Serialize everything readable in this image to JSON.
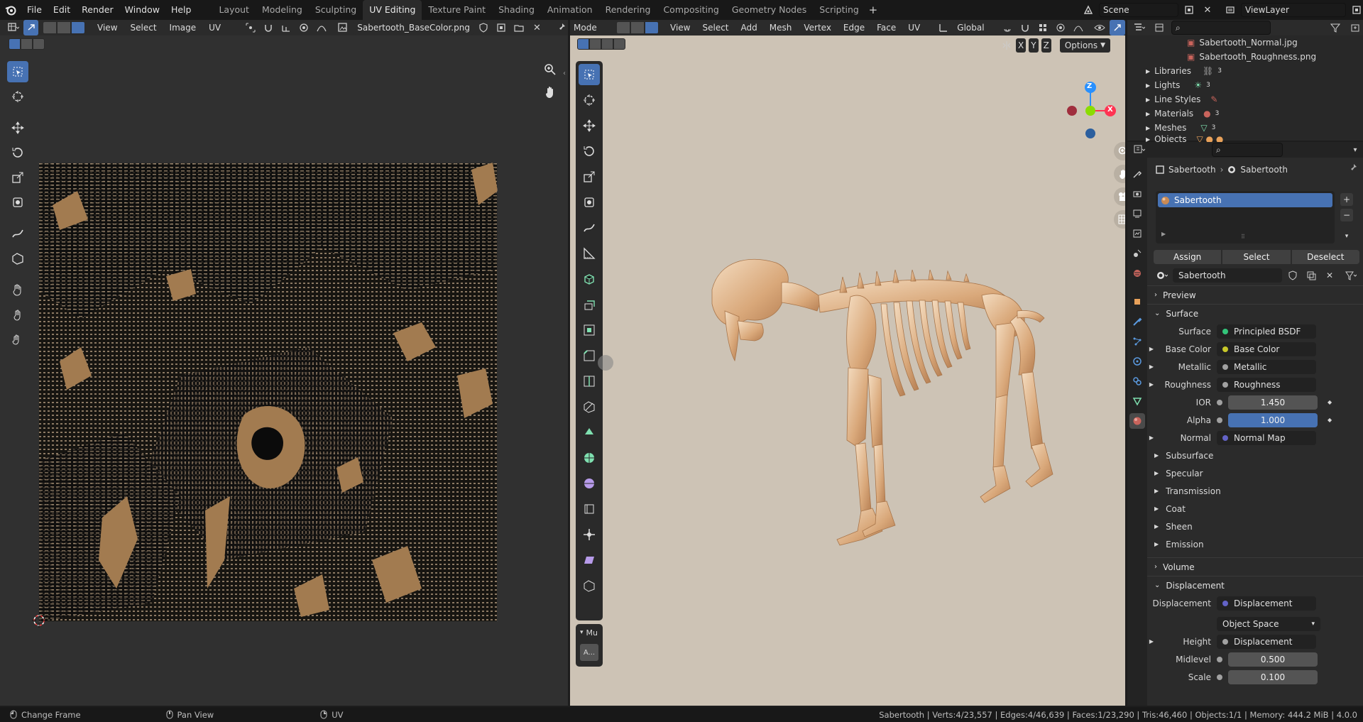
{
  "topbar": {
    "menus": [
      "File",
      "Edit",
      "Render",
      "Window",
      "Help"
    ],
    "workspaces": [
      "Layout",
      "Modeling",
      "Sculpting",
      "UV Editing",
      "Texture Paint",
      "Shading",
      "Animation",
      "Rendering",
      "Compositing",
      "Geometry Nodes",
      "Scripting"
    ],
    "active_workspace": "UV Editing",
    "scene": "Scene",
    "view_layer": "ViewLayer"
  },
  "uv_editor": {
    "menus": [
      "View",
      "Select",
      "Image",
      "UV"
    ],
    "image_name": "Sabertooth_BaseColor.png",
    "mode_icons": [
      "uv-select-mode-icon"
    ]
  },
  "viewport": {
    "mode": "Mode",
    "menus": [
      "View",
      "Select",
      "Add",
      "Mesh",
      "Vertex",
      "Edge",
      "Face",
      "UV"
    ],
    "orientation": "Global",
    "axes": [
      "X",
      "Y",
      "Z"
    ],
    "options_label": "Options",
    "gizmo_axes": {
      "x": "X",
      "y": "Y",
      "z": "Z"
    },
    "overlay_labels": [
      "Mu",
      "A..."
    ],
    "background_color": "#cdc3b5"
  },
  "outliner": {
    "items": [
      {
        "label": "Sabertooth_Normal.jpg",
        "type": "image",
        "indent": 2
      },
      {
        "label": "Sabertooth_Roughness.png",
        "type": "image",
        "indent": 2
      },
      {
        "label": "Libraries",
        "type": "folder",
        "count": "3"
      },
      {
        "label": "Lights",
        "type": "folder",
        "count": "3"
      },
      {
        "label": "Line Styles",
        "type": "folder",
        "count": ""
      },
      {
        "label": "Materials",
        "type": "folder",
        "count": "3"
      },
      {
        "label": "Meshes",
        "type": "folder",
        "count": "3"
      },
      {
        "label": "Objects",
        "type": "folder",
        "count": ""
      }
    ]
  },
  "properties": {
    "breadcrumb_object": "Sabertooth",
    "breadcrumb_material": "Sabertooth",
    "slot_name": "Sabertooth",
    "buttons": [
      "Assign",
      "Select",
      "Deselect"
    ],
    "material_name": "Sabertooth",
    "sections": {
      "preview": "Preview",
      "surface": "Surface",
      "volume": "Volume",
      "displacement": "Displacement"
    },
    "surface_rows": [
      {
        "label": "Surface",
        "value": "Principled BSDF",
        "dot": "#33c47a",
        "expand": false
      },
      {
        "label": "Base Color",
        "value": "Base Color",
        "dot": "#c7c729",
        "expand": true
      },
      {
        "label": "Metallic",
        "value": "Metallic",
        "dot": "#a1a1a1",
        "expand": true
      },
      {
        "label": "Roughness",
        "value": "Roughness",
        "dot": "#a1a1a1",
        "expand": true
      }
    ],
    "ior": {
      "label": "IOR",
      "value": "1.450"
    },
    "alpha": {
      "label": "Alpha",
      "value": "1.000"
    },
    "normal": {
      "label": "Normal",
      "value": "Normal Map",
      "dot": "#6363c7"
    },
    "subpanels": [
      "Subsurface",
      "Specular",
      "Transmission",
      "Coat",
      "Sheen",
      "Emission"
    ],
    "displacement_rows": {
      "displacement": {
        "label": "Displacement",
        "value": "Displacement",
        "dot": "#6363c7"
      },
      "space": "Object Space",
      "height": {
        "label": "Height",
        "value": "Displacement",
        "dot": "#a1a1a1"
      },
      "midlevel": {
        "label": "Midlevel",
        "value": "0.500"
      },
      "scale": {
        "label": "Scale",
        "value": "0.100"
      }
    }
  },
  "status": {
    "hints": [
      "Change Frame",
      "Pan View",
      "UV"
    ],
    "stats": "Sabertooth | Verts:4/23,557 | Edges:4/46,639 | Faces:1/23,290 | Tris:46,460 | Objects:1/1 | Memory: 444.2 MiB | 4.0.0"
  },
  "colors": {
    "accent": "#4772b3",
    "axis_x": "#ff3352",
    "axis_y": "#8bdc00",
    "axis_z": "#2890ff",
    "bone": "#e4bc98"
  }
}
